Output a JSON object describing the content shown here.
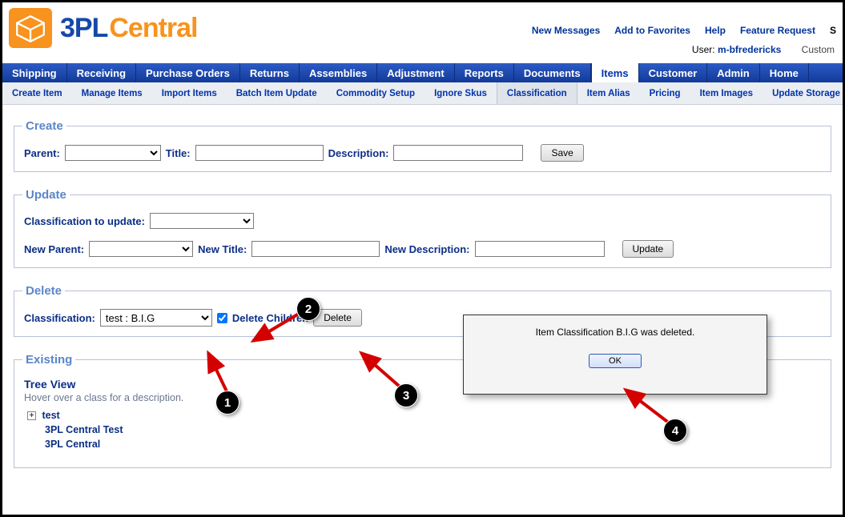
{
  "header": {
    "brand_p1": "3PL",
    "brand_p2": "Central",
    "top_links": [
      "New Messages",
      "Add to Favorites",
      "Help",
      "Feature Request"
    ],
    "top_trail": "S",
    "user_label": "User:",
    "user_value": "m-bfredericks",
    "cust_trail": "Custom"
  },
  "main_nav": {
    "items": [
      "Shipping",
      "Receiving",
      "Purchase Orders",
      "Returns",
      "Assemblies",
      "Adjustment",
      "Reports",
      "Documents",
      "Items",
      "Customer",
      "Admin",
      "Home"
    ],
    "active_index": 8
  },
  "sub_nav": {
    "items": [
      "Create Item",
      "Manage Items",
      "Import Items",
      "Batch Item Update",
      "Commodity Setup",
      "Ignore Skus",
      "Classification",
      "Item Alias",
      "Pricing",
      "Item Images",
      "Update Storage Ra"
    ],
    "active_index": 6
  },
  "create": {
    "legend": "Create",
    "parent_label": "Parent:",
    "title_label": "Title:",
    "desc_label": "Description:",
    "save_btn": "Save"
  },
  "update": {
    "legend": "Update",
    "class_label": "Classification to update:",
    "newparent_label": "New Parent:",
    "newtitle_label": "New Title:",
    "newdesc_label": "New Description:",
    "update_btn": "Update"
  },
  "delete": {
    "legend": "Delete",
    "class_label": "Classification:",
    "class_value": "test : B.I.G",
    "delchildren_label": "Delete Children",
    "delchildren_checked": true,
    "delete_btn": "Delete"
  },
  "existing": {
    "legend": "Existing",
    "tree_title": "Tree View",
    "tree_hint": "Hover over a class for a description.",
    "items": [
      {
        "label": "test",
        "has_children": true
      },
      {
        "label": "3PL Central Test",
        "has_children": false,
        "indent": true
      },
      {
        "label": "3PL Central",
        "has_children": false,
        "indent": true
      }
    ]
  },
  "dialog": {
    "message": "Item Classification B.I.G was deleted.",
    "ok_btn": "OK"
  },
  "annotations": {
    "n1": "1",
    "n2": "2",
    "n3": "3",
    "n4": "4"
  }
}
